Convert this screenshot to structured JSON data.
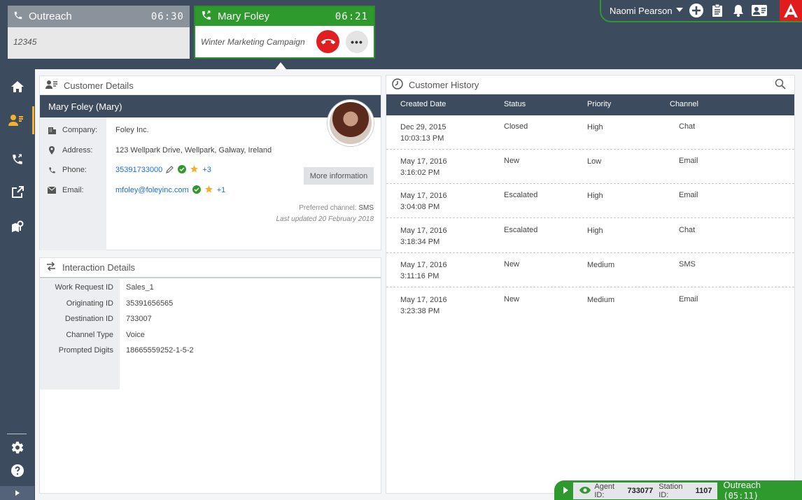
{
  "calls": [
    {
      "name": "Outreach",
      "timer": "06:30",
      "detail": "12345"
    },
    {
      "name": "Mary Foley",
      "timer": "06:21",
      "detail": "Winter Marketing Campaign"
    }
  ],
  "topbar": {
    "user": "Naomi Pearson"
  },
  "customer_details": {
    "title": "Customer Details",
    "name": "Mary Foley (Mary)",
    "company_label": "Company:",
    "company": "Foley Inc.",
    "address_label": "Address:",
    "address": "123 Wellpark Drive, Wellpark, Galway, Ireland",
    "phone_label": "Phone:",
    "phone": "35391733000",
    "phone_extra": "+3",
    "email_label": "Email:",
    "email": "mfoley@foleyinc.com",
    "email_extra": "+1",
    "more_info": "More information",
    "preferred_prefix": "Preferred channel:",
    "preferred_channel": "SMS",
    "last_updated": "Last updated 20 February 2018"
  },
  "interaction_details": {
    "title": "Interaction Details",
    "rows": [
      {
        "key": "Work Request ID",
        "value": "Sales_1"
      },
      {
        "key": "Originating ID",
        "value": "35391656565"
      },
      {
        "key": "Destination ID",
        "value": "733007"
      },
      {
        "key": "Channel Type",
        "value": "Voice"
      },
      {
        "key": "Prompted Digits",
        "value": "18665559252-1-5-2"
      }
    ]
  },
  "customer_history": {
    "title": "Customer History",
    "columns": [
      "Created Date",
      "Status",
      "Priority",
      "Channel"
    ],
    "rows": [
      {
        "date": "Dec 29, 2015",
        "time": "10:03:13 PM",
        "status": "Closed",
        "priority": "High",
        "channel": "Chat"
      },
      {
        "date": "May 17, 2016",
        "time": "3:16:02 PM",
        "status": "New",
        "priority": "Low",
        "channel": "Email"
      },
      {
        "date": "May 17, 2016",
        "time": "3:04:08 PM",
        "status": "Escalated",
        "priority": "High",
        "channel": "Email"
      },
      {
        "date": "May 17, 2016",
        "time": "3:18:34 PM",
        "status": "Escalated",
        "priority": "High",
        "channel": "Chat"
      },
      {
        "date": "May 17, 2016",
        "time": "3:11:16 PM",
        "status": "New",
        "priority": "Medium",
        "channel": "SMS"
      },
      {
        "date": "May 17, 2016",
        "time": "3:23:38 PM",
        "status": "New",
        "priority": "Medium",
        "channel": "Email"
      }
    ]
  },
  "status_bar": {
    "agent_label": "Agent ID:",
    "agent_id": "733077",
    "station_label": "Station ID:",
    "station_id": "1107",
    "mode": "Outreach",
    "timer": "(05:11)"
  },
  "colors": {
    "accent_green": "#2e9a2e",
    "nav_bg": "#3d4b5f",
    "hangup_red": "#e02020",
    "brand_red": "#e01c1c",
    "active_nav": "#f2b22c"
  }
}
